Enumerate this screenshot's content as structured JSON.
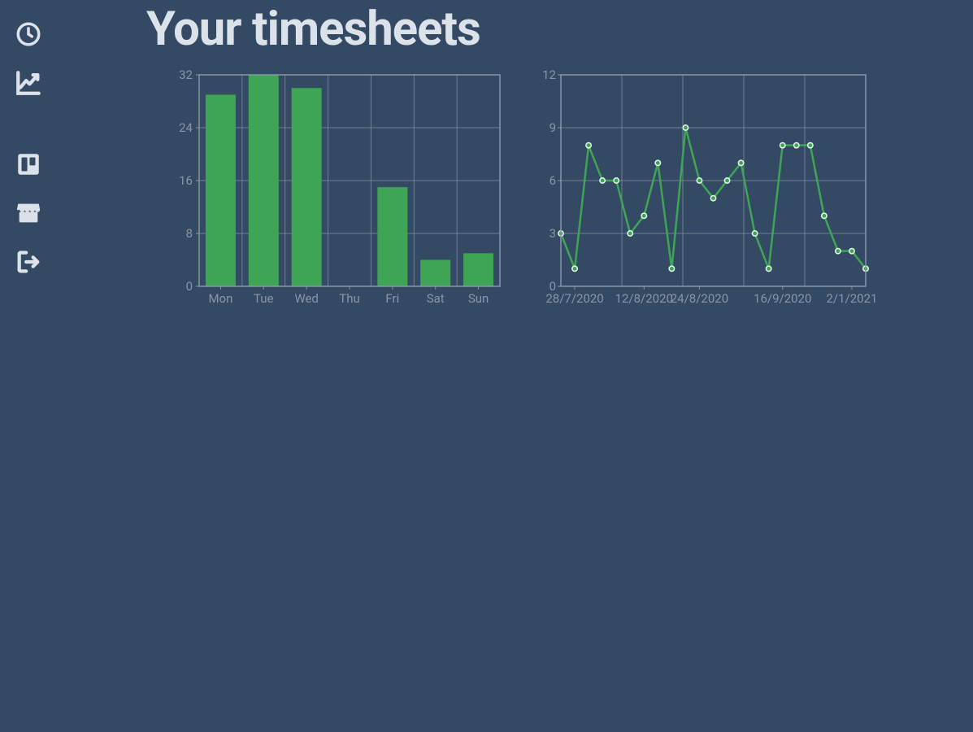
{
  "sidebar": {
    "items": [
      {
        "name": "clock-icon"
      },
      {
        "name": "chart-line-icon"
      },
      {
        "name": "trello-icon"
      },
      {
        "name": "store-icon"
      },
      {
        "name": "logout-icon"
      }
    ]
  },
  "page": {
    "title": "Your timesheets"
  },
  "chart_data": [
    {
      "type": "bar",
      "title": "",
      "xlabel": "",
      "ylabel": "",
      "ylim": [
        0,
        32
      ],
      "yticks": [
        0,
        8,
        16,
        24,
        32
      ],
      "categories": [
        "Mon",
        "Tue",
        "Wed",
        "Thu",
        "Fri",
        "Sat",
        "Sun"
      ],
      "values": [
        29,
        32,
        30,
        0,
        15,
        4,
        5
      ]
    },
    {
      "type": "line",
      "title": "",
      "xlabel": "",
      "ylabel": "",
      "ylim": [
        0,
        12
      ],
      "yticks": [
        0,
        3,
        6,
        9,
        12
      ],
      "xticks": [
        "28/7/2020",
        "12/8/2020",
        "24/8/2020",
        "16/9/2020",
        "2/1/2021"
      ],
      "values": [
        3,
        1,
        8,
        6,
        6,
        3,
        4,
        7,
        1,
        9,
        6,
        5,
        6,
        7,
        3,
        1,
        8,
        8,
        8,
        4,
        2,
        2,
        1
      ]
    }
  ],
  "colors": {
    "accent": "#3ea556",
    "bg": "#344963",
    "muted": "#8a96a6",
    "text": "#dbe2ea"
  }
}
